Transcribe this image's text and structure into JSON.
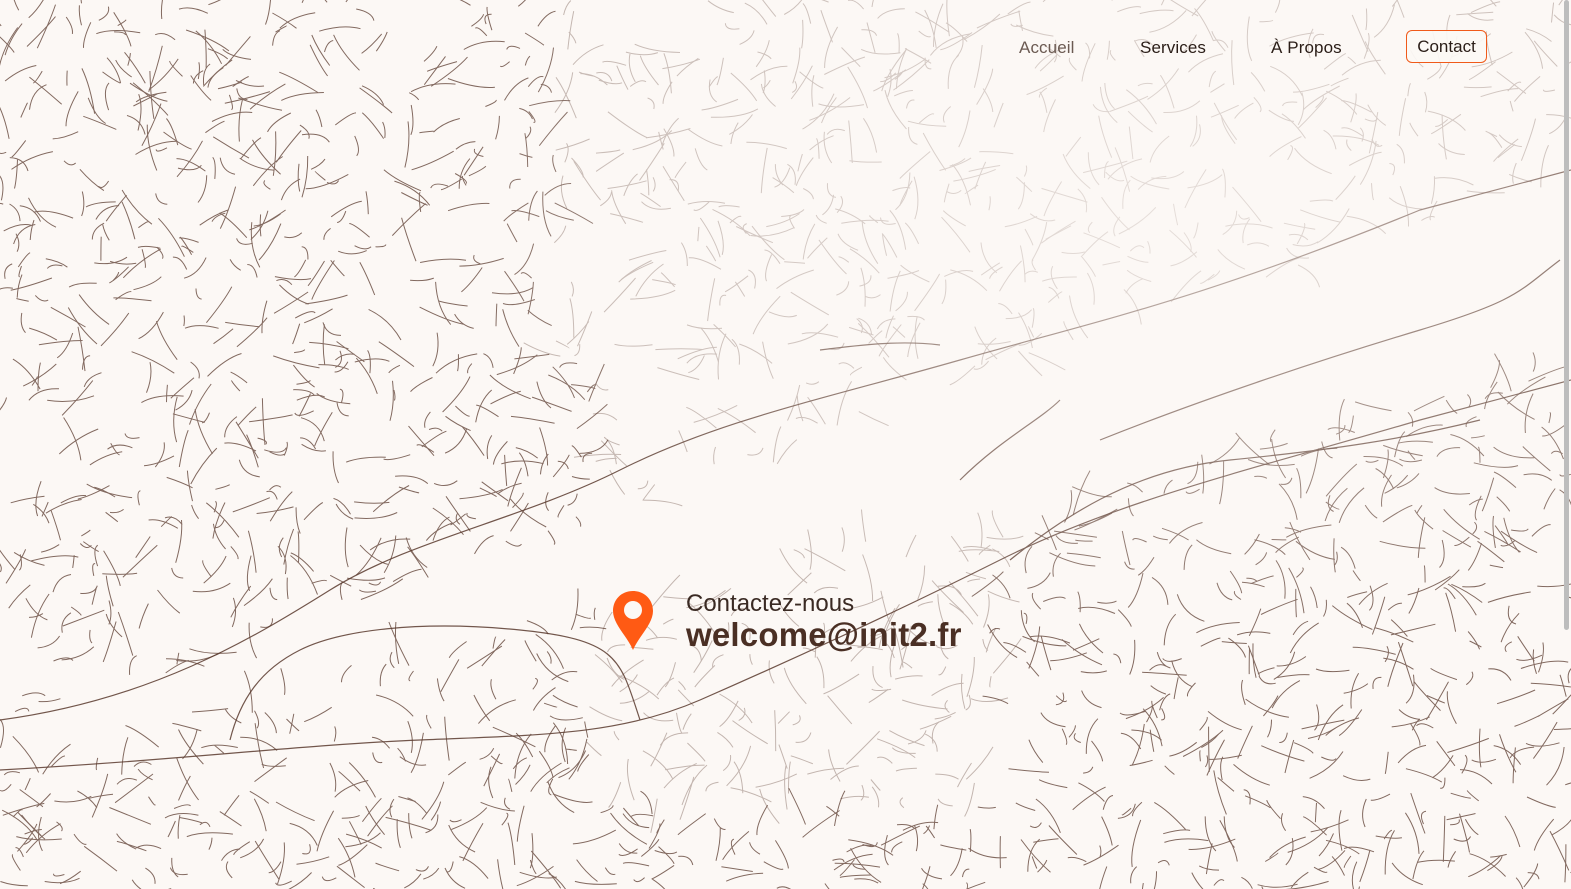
{
  "nav": {
    "items": [
      {
        "label": "Accueil"
      },
      {
        "label": "Services"
      },
      {
        "label": "À Propos"
      }
    ],
    "contact_label": "Contact"
  },
  "contact": {
    "label": "Contactez-nous",
    "email": "welcome@init2.fr",
    "pin_icon": "map-pin-icon"
  },
  "colors": {
    "background": "#fcf8f5",
    "accent": "#f05a1a",
    "map_lines": "#5a3a2e",
    "text_dark": "#4a2f24"
  }
}
